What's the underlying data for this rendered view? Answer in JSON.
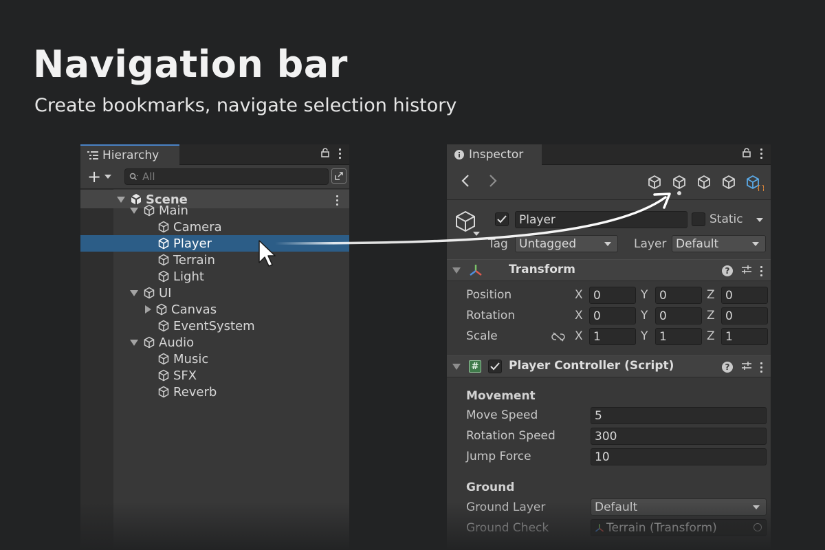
{
  "headline": "Navigation bar",
  "subline": "Create bookmarks, navigate selection history",
  "hierarchy": {
    "tab_label": "Hierarchy",
    "search_placeholder": "All",
    "scene_label": "Scene",
    "items": [
      {
        "label": "Main",
        "depth": 1,
        "expander": "expanded"
      },
      {
        "label": "Camera",
        "depth": 2,
        "expander": "none"
      },
      {
        "label": "Player",
        "depth": 2,
        "expander": "none",
        "selected": true
      },
      {
        "label": "Terrain",
        "depth": 2,
        "expander": "none"
      },
      {
        "label": "Light",
        "depth": 2,
        "expander": "none"
      },
      {
        "label": "UI",
        "depth": 1,
        "expander": "expanded"
      },
      {
        "label": "Canvas",
        "depth": 2,
        "expander": "collapsed"
      },
      {
        "label": "EventSystem",
        "depth": 2,
        "expander": "none"
      },
      {
        "label": "Audio",
        "depth": 1,
        "expander": "expanded"
      },
      {
        "label": "Music",
        "depth": 2,
        "expander": "none"
      },
      {
        "label": "SFX",
        "depth": 2,
        "expander": "none"
      },
      {
        "label": "Reverb",
        "depth": 2,
        "expander": "none"
      }
    ]
  },
  "inspector": {
    "tab_label": "Inspector",
    "bookmark_icons": [
      "cube-icon",
      "cube-icon",
      "cube-icon",
      "cube-icon",
      "prefab-script-icon"
    ],
    "object": {
      "name": "Player",
      "active": true,
      "static_label": "Static",
      "tag_label": "Tag",
      "tag_value": "Untagged",
      "layer_label": "Layer",
      "layer_value": "Default"
    },
    "transform": {
      "title": "Transform",
      "rows": [
        {
          "label": "Position",
          "x": "0",
          "y": "0",
          "z": "0"
        },
        {
          "label": "Rotation",
          "x": "0",
          "y": "0",
          "z": "0"
        },
        {
          "label": "Scale",
          "x": "1",
          "y": "1",
          "z": "1"
        }
      ],
      "axes": [
        "X",
        "Y",
        "Z"
      ]
    },
    "script": {
      "title": "Player Controller (Script)",
      "enabled": true,
      "movement_header": "Movement",
      "fields": [
        {
          "label": "Move Speed",
          "value": "5"
        },
        {
          "label": "Rotation Speed",
          "value": "300"
        },
        {
          "label": "Jump Force",
          "value": "10"
        }
      ],
      "ground_header": "Ground",
      "ground_layer_label": "Ground Layer",
      "ground_layer_value": "Default",
      "ground_check_label": "Ground Check",
      "ground_check_value": "Terrain (Transform)"
    }
  },
  "colors": {
    "background": "#222324",
    "selection": "#2c5d87",
    "accent_blue": "#4a83c6",
    "bookmark_active": "#5aa9e6"
  }
}
